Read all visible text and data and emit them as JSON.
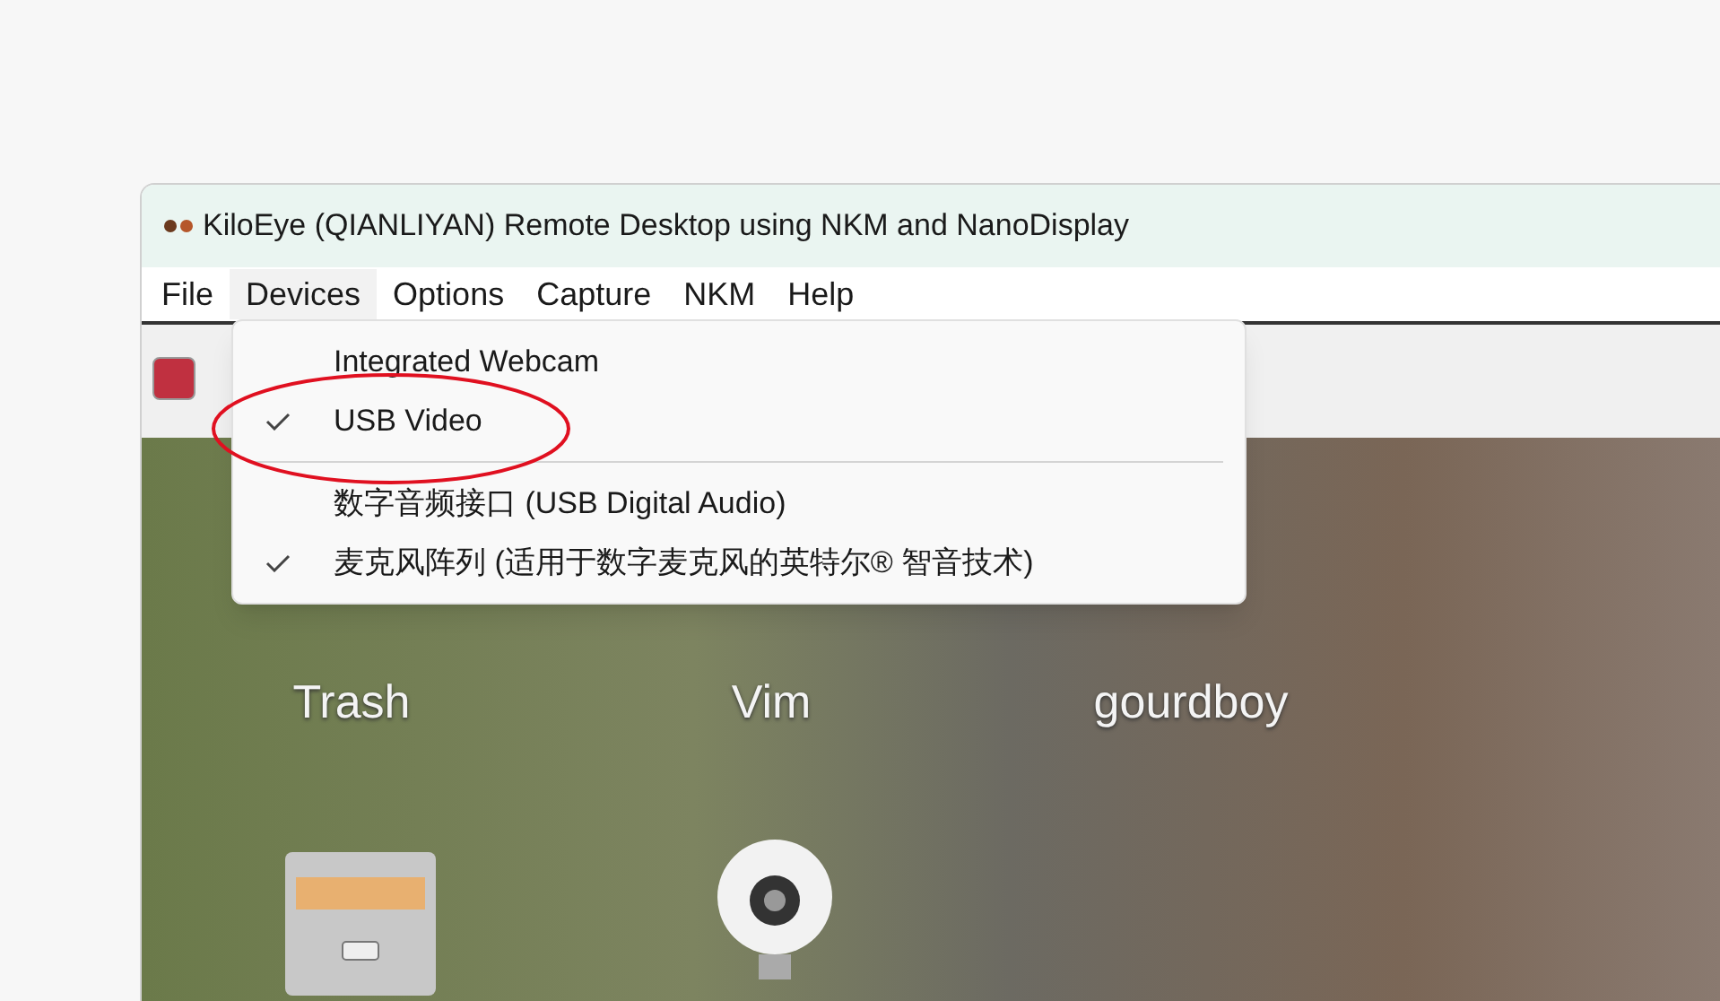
{
  "window": {
    "title": "KiloEye (QIANLIYAN) Remote Desktop using NKM and NanoDisplay"
  },
  "menu_bar": [
    {
      "label": "File",
      "selected": false
    },
    {
      "label": "Devices",
      "selected": true
    },
    {
      "label": "Options",
      "selected": false
    },
    {
      "label": "Capture",
      "selected": false
    },
    {
      "label": "NKM",
      "selected": false
    },
    {
      "label": "Help",
      "selected": false
    }
  ],
  "devices_menu": [
    {
      "kind": "item",
      "label": "Integrated Webcam",
      "checked": false
    },
    {
      "kind": "item",
      "label": "USB Video",
      "checked": true
    },
    {
      "kind": "separator"
    },
    {
      "kind": "item",
      "label": "数字音频接口 (USB Digital Audio)",
      "checked": false
    },
    {
      "kind": "item",
      "label": "麦克风阵列 (适用于数字麦克风的英特尔® 智音技术)",
      "checked": true
    }
  ],
  "remote_desktop": {
    "icons": [
      {
        "label": "Trash"
      },
      {
        "label": "Vim"
      },
      {
        "label": "gourdboy"
      }
    ]
  }
}
